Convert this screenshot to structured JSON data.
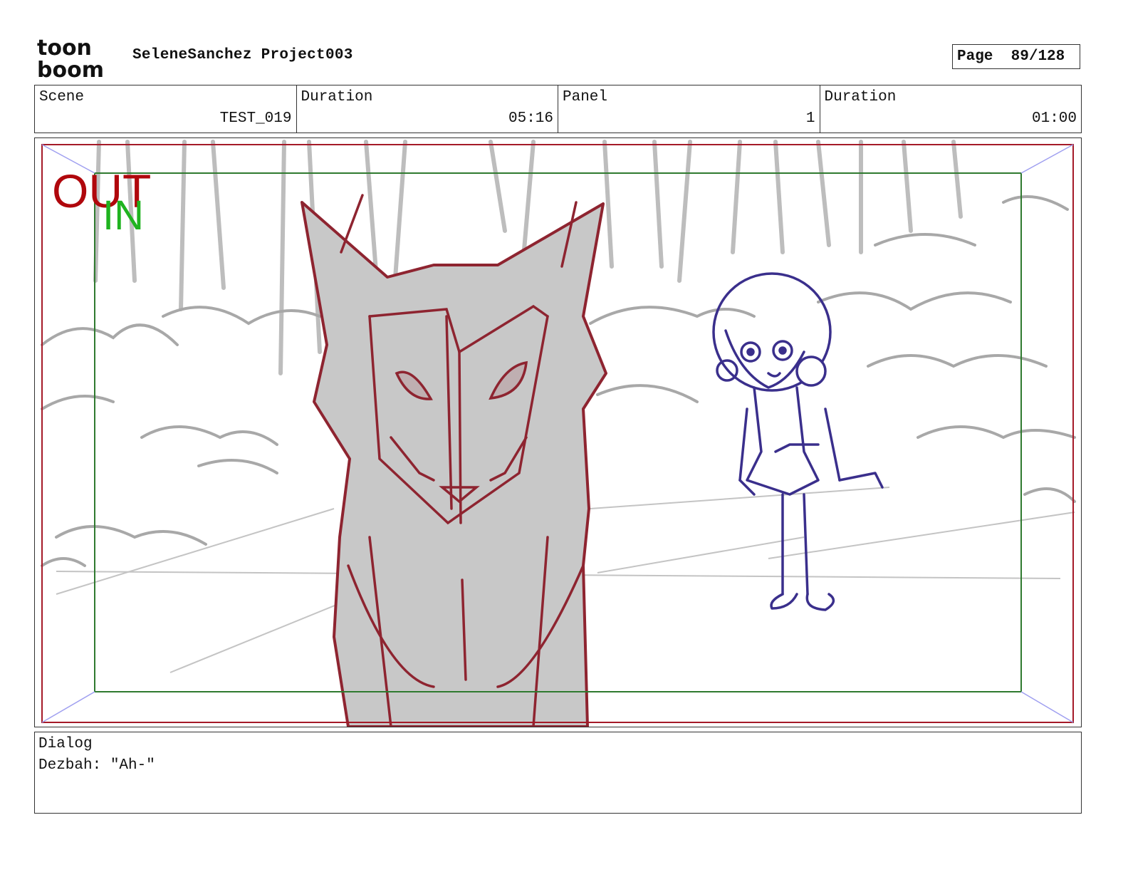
{
  "header": {
    "logo_text_top": "toon",
    "logo_text_bottom": "boom",
    "project_title": "SeleneSanchez Project003",
    "page_label": "Page",
    "page_value": "89/128"
  },
  "info": {
    "scene_label": "Scene",
    "scene_value": "TEST_019",
    "scene_duration_label": "Duration",
    "scene_duration_value": "05:16",
    "panel_label": "Panel",
    "panel_value": "1",
    "panel_duration_label": "Duration",
    "panel_duration_value": "01:00"
  },
  "frame": {
    "out_label": "OUT",
    "in_label": "IN",
    "colors": {
      "out": "#b0070c",
      "in": "#1fb31f",
      "wolf_line": "#8e2430",
      "wolf_fill": "#c8c8c8",
      "girl_line": "#3a2f8c",
      "background_line": "#b8b8b8"
    }
  },
  "dialog": {
    "label": "Dialog",
    "text": "Dezbah: \"Ah-\""
  }
}
